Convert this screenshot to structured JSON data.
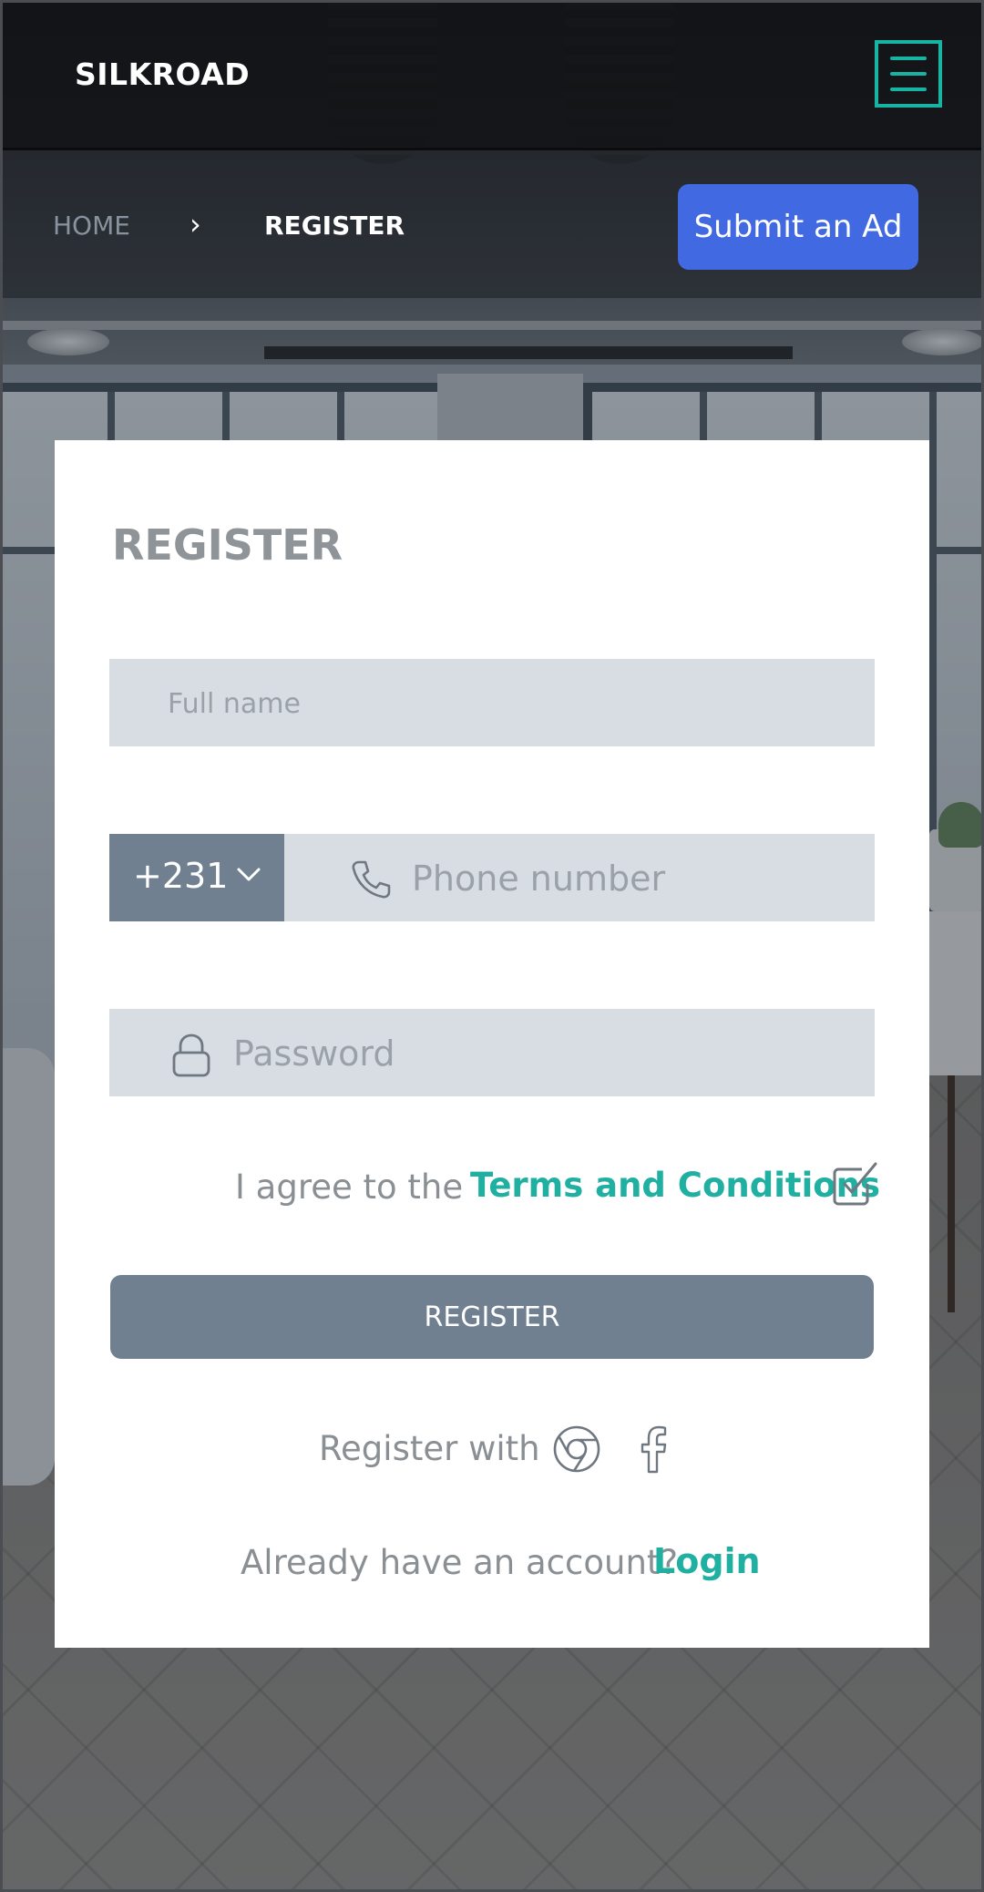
{
  "app": {
    "brand": "SILKROAD"
  },
  "header": {
    "menu_icon": "hamburger-icon",
    "accent_color": "#17b3a3"
  },
  "breadcrumb": {
    "home": "HOME",
    "separator": "›",
    "current": "REGISTER"
  },
  "submit_ad": {
    "label": "Submit an Ad",
    "color": "#4169e1"
  },
  "form": {
    "title": "REGISTER",
    "full_name": {
      "placeholder": "Full name",
      "value": ""
    },
    "phone": {
      "country_code": "+231",
      "placeholder": "Phone number",
      "value": "",
      "icon": "phone-icon",
      "chevron": "chevron-down-icon"
    },
    "password": {
      "placeholder": "Password",
      "value": "",
      "icon": "lock-icon"
    },
    "agree": {
      "text": "I agree to the",
      "terms_link": "Terms and Conditions",
      "checked": true
    },
    "submit_label": "REGISTER",
    "button_color": "#708090",
    "social": {
      "label": "Register with",
      "icons": [
        "google-chrome-icon",
        "facebook-icon"
      ]
    },
    "login": {
      "prompt": "Already have an account?",
      "link": "Login",
      "link_color": "#1fb0a2"
    }
  }
}
